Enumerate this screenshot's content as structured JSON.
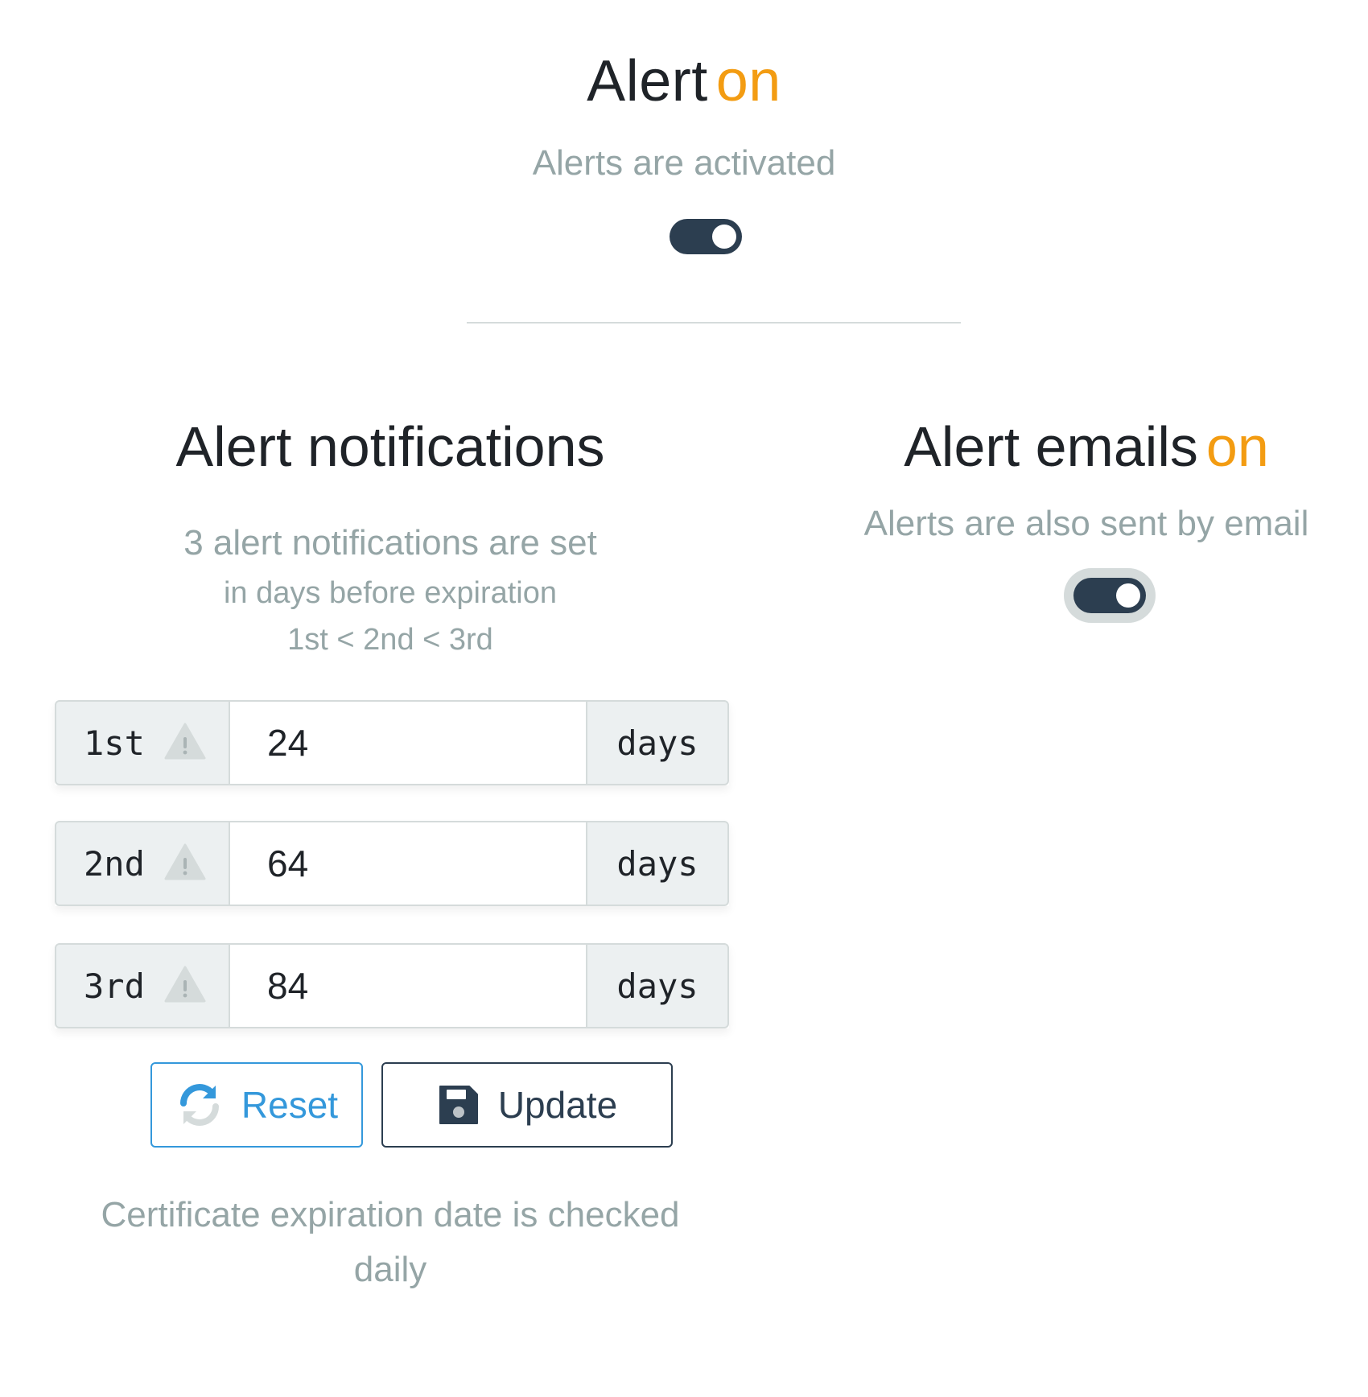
{
  "alert": {
    "title": "Alert",
    "state": "on",
    "subtitle": "Alerts are activated",
    "enabled": true
  },
  "notifications": {
    "title": "Alert notifications",
    "subtitle_line1": "3 alert notifications are set",
    "subtitle_line2": "in days before expiration",
    "subtitle_line3": "1st < 2nd < 3rd",
    "rows": [
      {
        "label": "1st",
        "value": "24",
        "unit": "days"
      },
      {
        "label": "2nd",
        "value": "64",
        "unit": "days"
      },
      {
        "label": "3rd",
        "value": "84",
        "unit": "days"
      }
    ],
    "reset_label": "Reset",
    "update_label": "Update",
    "footer_note": "Certificate expiration date is checked daily"
  },
  "emails": {
    "title": "Alert emails",
    "state": "on",
    "subtitle": "Alerts are also sent by email",
    "enabled": true
  },
  "colors": {
    "accent_orange": "#f39c12",
    "muted_gray": "#95a5a6",
    "dark_navy": "#2c3e50",
    "reset_blue": "#3498db"
  },
  "icons": {
    "warning": "warning-triangle-icon",
    "reset": "refresh-icon",
    "update": "floppy-disk-icon"
  }
}
